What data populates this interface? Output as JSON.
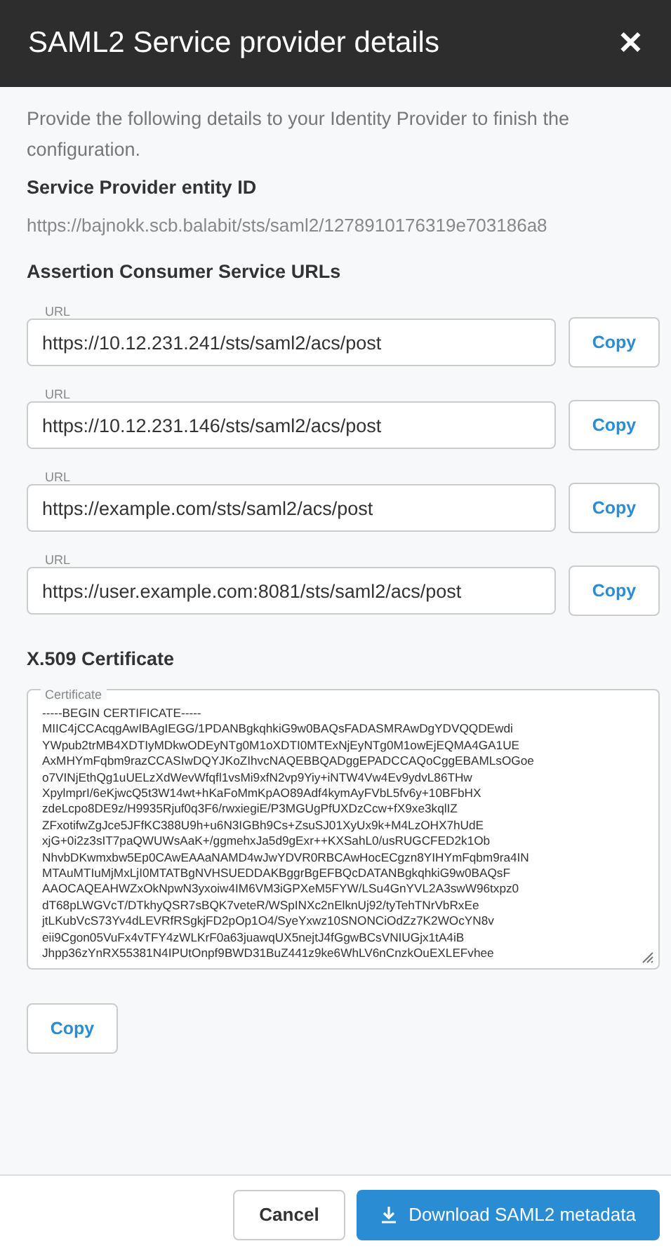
{
  "dialog": {
    "title": "SAML2 Service provider details",
    "close_label": "✕"
  },
  "intro": "Provide the following details to your Identity Provider to finish the configuration.",
  "entity_id": {
    "heading": "Service Provider entity ID",
    "value": "https://bajnokk.scb.balabit/sts/saml2/1278910176319e703186a8"
  },
  "acs": {
    "heading": "Assertion Consumer Service URLs",
    "fields": [
      {
        "label": "URL",
        "value": "https://10.12.231.241/sts/saml2/acs/post",
        "button": "Copy"
      },
      {
        "label": "URL",
        "value": "https://10.12.231.146/sts/saml2/acs/post",
        "button": "Copy"
      },
      {
        "label": "URL",
        "value": "https://example.com/sts/saml2/acs/post",
        "button": "Copy"
      },
      {
        "label": "URL",
        "value": "https://user.example.com:8081/sts/saml2/acs/post",
        "button": "Copy"
      }
    ]
  },
  "certificate": {
    "heading": "X.509 Certificate",
    "label": "Certificate",
    "button": "Copy",
    "lines": [
      "-----BEGIN CERTIFICATE-----",
      "MIIC4jCCAcqgAwIBAgIEGG/1PDANBgkqhkiG9w0BAQsFADASMRAwDgYDVQQDEwdi",
      "YWpub2trMB4XDTIyMDkwODEyNTg0M1oXDTI0MTExNjEyNTg0M1owEjEQMA4GA1UE",
      "AxMHYmFqbm9razCCASIwDQYJKoZIhvcNAQEBBQADggEPADCCAQoCggEBAMLsOGoe",
      "o7VINjEthQg1uUELzXdWevWfqfl1vsMi9xfN2vp9Yiy+iNTW4Vw4Ev9ydvL86THw",
      "XpylmprI/6eKjwcQ5t3W14wt+hKaFoMmKpAO89Adf4kymAyFVbL5fv6y+10BFbHX",
      "zdeLcpo8DE9z/H9935Rjuf0q3F6/rwxiegiE/P3MGUgPfUXDzCcw+fX9xe3kqlIZ",
      "ZFxotifwZgJce5JFfKC388U9h+u6N3IGBh9Cs+ZsuSJ01XyUx9k+M4LzOHX7hUdE",
      "xjG+0i2z3sIT7paQWUWsAaK+/ggmehxJa5d9gExr++KXSahL0/usRUGCFED2k1Ob",
      "NhvbDKwmxbw5Ep0CAwEAAaNAMD4wJwYDVR0RBCAwHocECgzn8YIHYmFqbm9ra4IN",
      "MTAuMTIuMjMxLjI0MTATBgNVHSUEDDAKBggrBgEFBQcDATANBgkqhkiG9w0BAQsF",
      "AAOCAQEAHWZxOkNpwN3yxoiw4IM6VM3iGPXeM5FYW/LSu4GnYVL2A3swW96txpz0",
      "dT68pLWGVcT/DTkhyQSR7sBQK7veteR/WSpINXc2nElknUj92/tyTehTNrVbRxEe",
      "jtLKubVcS73Yv4dLEVRfRSgkjFD2pOp1O4/SyeYxwz10SNONCiOdZz7K2WOcYN8v",
      "eii9Cgon05VuFx4vTFY4zWLKrF0a63juawqUX5nejtJ4fGgwBCsVNIUGjx1tA4iB",
      "Jhpp36zYnRX55381N4IPUtOnpf9BWD31BuZ441z9ke6WhLV6nCnzkOuEXLEFvhee"
    ]
  },
  "footer": {
    "cancel": "Cancel",
    "download": "Download SAML2 metadata"
  }
}
